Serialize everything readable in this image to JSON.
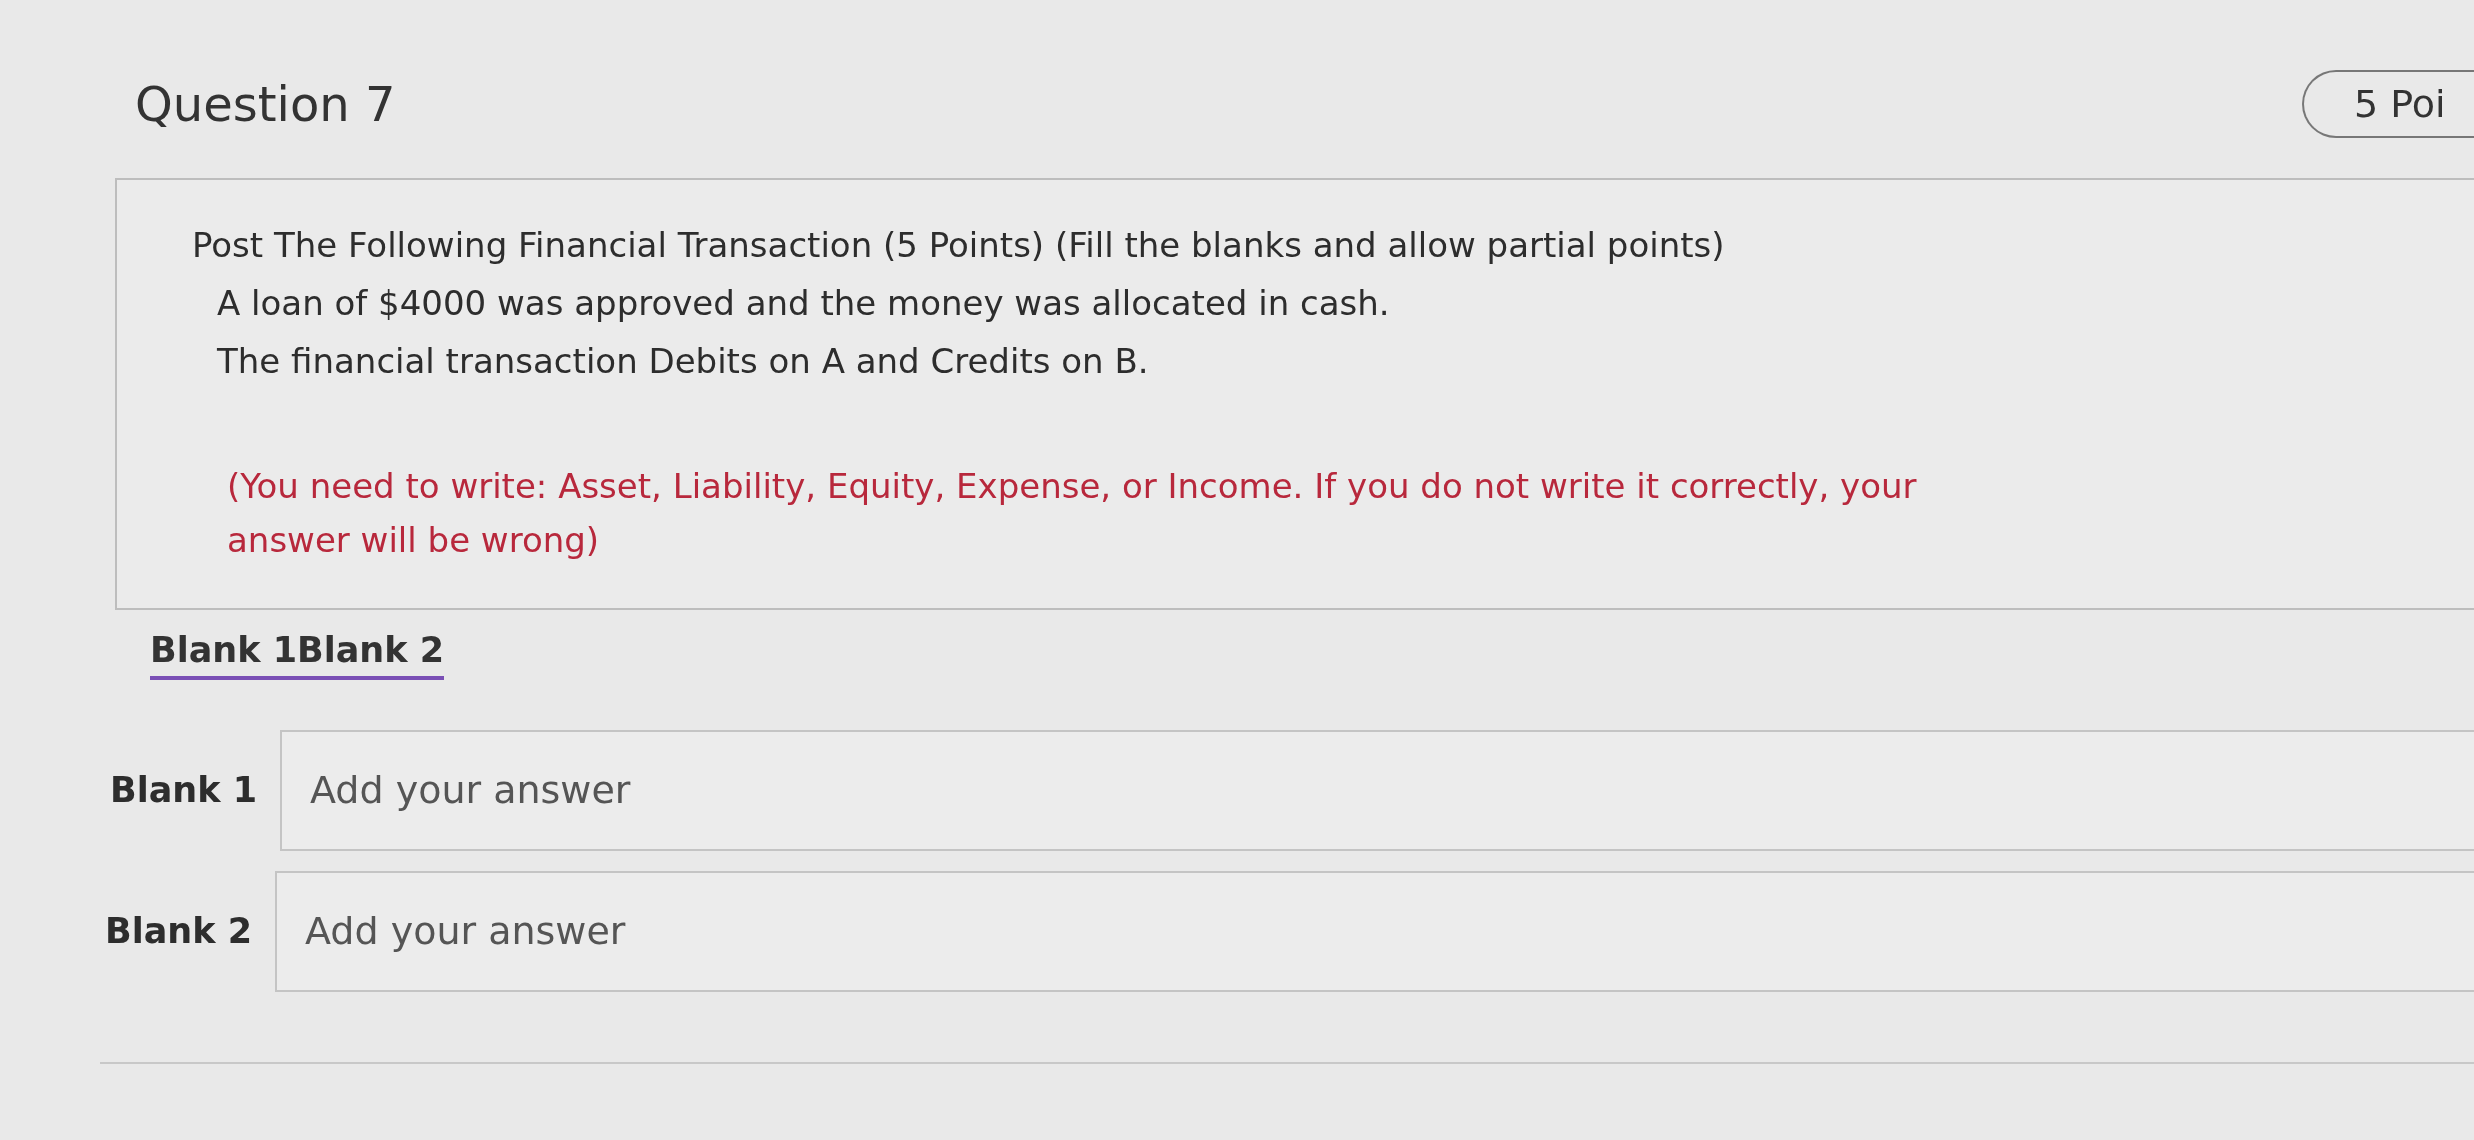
{
  "question": {
    "title": "Question 7",
    "points": "5 Poi"
  },
  "prompt": {
    "heading": "Post The Following Financial Transaction (5 Points) (Fill the blanks and allow partial points)",
    "lines": [
      "A loan of $4000 was approved and the money was allocated in cash.",
      "The financial transaction Debits on A and Credits on B."
    ],
    "note": "(You need to write: Asset, Liability, Equity, Expense, or Income. If you do not write it correctly, your answer will be wrong)"
  },
  "blank_tabs": "Blank 1Blank 2",
  "blanks": [
    {
      "label": "Blank 1",
      "placeholder": "Add your answer"
    },
    {
      "label": "Blank 2",
      "placeholder": "Add your answer"
    }
  ]
}
